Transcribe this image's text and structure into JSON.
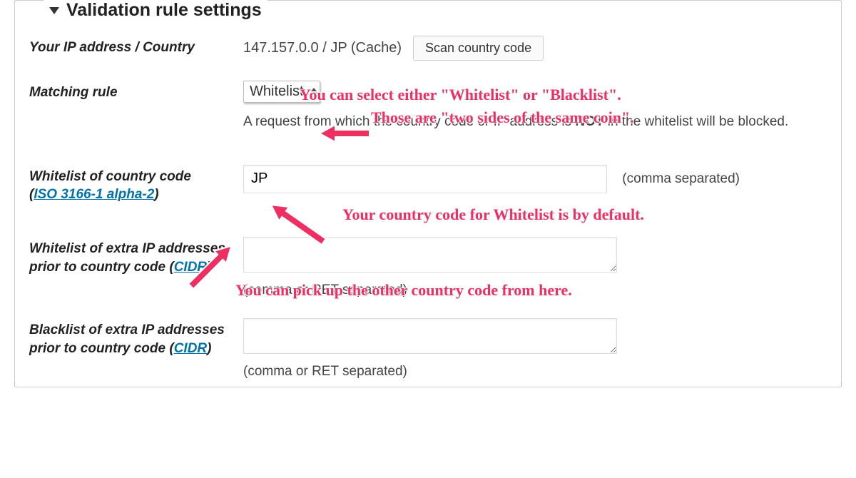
{
  "section_title": "Validation rule settings",
  "ip_row": {
    "label": "Your IP address / Country",
    "value": "147.157.0.0 / JP (Cache)",
    "scan_btn": "Scan country code"
  },
  "matching": {
    "label": "Matching rule",
    "selected": "Whitelist",
    "help_pre": "A request from which the country code or IP address is ",
    "help_bold": "NOT",
    "help_post": " in the whitelist will be blocked."
  },
  "whitelist_cc": {
    "label_main": "Whitelist of country code",
    "label_link": "ISO 3166-1 alpha-2",
    "value": "JP",
    "hint": "(comma separated)"
  },
  "wl_ip": {
    "label_main": "Whitelist of extra IP addresses prior to country code (",
    "label_link": "CIDR",
    "label_close": ")",
    "hint": "(comma or RET separated)"
  },
  "bl_ip": {
    "label_main": "Blacklist of extra IP addresses prior to country code (",
    "label_link": "CIDR",
    "label_close": ")",
    "hint": "(comma or RET separated)"
  },
  "annotations": {
    "a1_line1": "You can select either \"Whitelist\" or \"Blacklist\".",
    "a1_line2": "Those are \"two sides of the same coin\".",
    "a2": "Your country code for Whitelist is by default.",
    "a3": "You can pick up the other country code from here."
  }
}
